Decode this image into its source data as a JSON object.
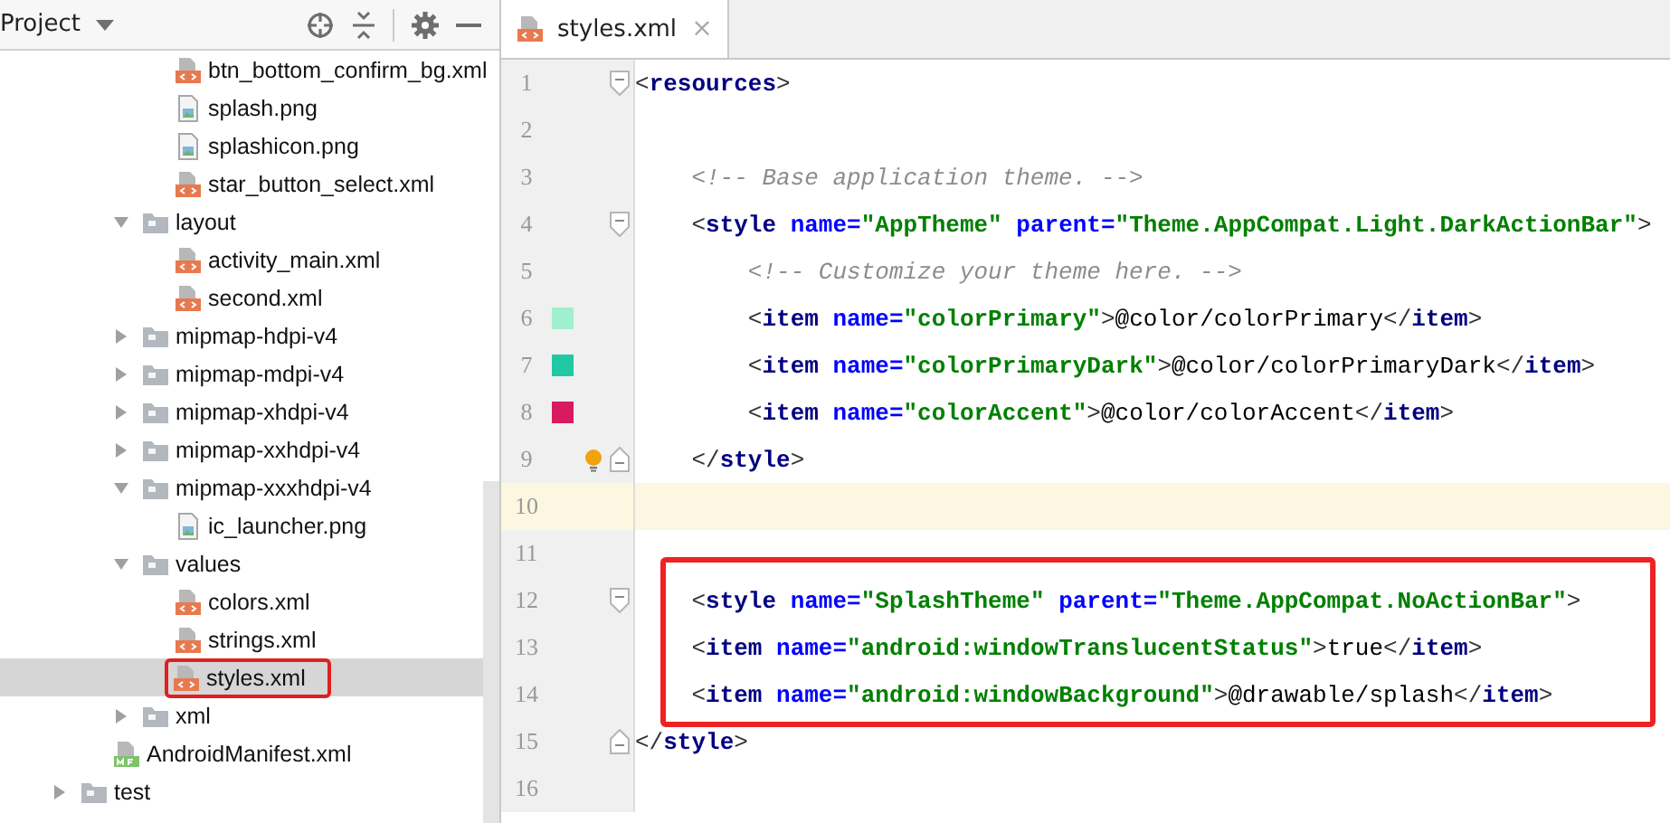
{
  "project_panel": {
    "title": "Project",
    "tree": [
      {
        "children": [
          {
            "children": [
              {
                "children": [
                  {
                    "label": "btn_bottom_confirm_bg.xml",
                    "kind": "xml",
                    "selected": false,
                    "boxed": false
                  },
                  {
                    "label": "splash.png",
                    "kind": "png",
                    "selected": false,
                    "boxed": false
                  },
                  {
                    "label": "splashicon.png",
                    "kind": "png",
                    "selected": false,
                    "boxed": false
                  },
                  {
                    "label": "star_button_select.xml",
                    "kind": "xml",
                    "selected": false,
                    "boxed": false
                  }
                ]
              },
              {
                "label": "layout",
                "kind": "folder",
                "expanded": true,
                "children": [
                  {
                    "label": "activity_main.xml",
                    "kind": "xml",
                    "selected": false,
                    "boxed": false
                  },
                  {
                    "label": "second.xml",
                    "kind": "xml",
                    "selected": false,
                    "boxed": false
                  }
                ]
              },
              {
                "label": "mipmap-hdpi-v4",
                "kind": "folder",
                "expanded": false
              },
              {
                "label": "mipmap-mdpi-v4",
                "kind": "folder",
                "expanded": false
              },
              {
                "label": "mipmap-xhdpi-v4",
                "kind": "folder",
                "expanded": false
              },
              {
                "label": "mipmap-xxhdpi-v4",
                "kind": "folder",
                "expanded": false
              },
              {
                "label": "mipmap-xxxhdpi-v4",
                "kind": "folder",
                "expanded": true,
                "children": [
                  {
                    "label": "ic_launcher.png",
                    "kind": "png",
                    "selected": false,
                    "boxed": false
                  }
                ]
              },
              {
                "label": "values",
                "kind": "folder",
                "expanded": true,
                "children": [
                  {
                    "label": "colors.xml",
                    "kind": "xml",
                    "selected": false,
                    "boxed": false
                  },
                  {
                    "label": "strings.xml",
                    "kind": "xml",
                    "selected": false,
                    "boxed": false
                  },
                  {
                    "label": "styles.xml",
                    "kind": "xml",
                    "selected": true,
                    "boxed": true
                  }
                ]
              },
              {
                "label": "xml",
                "kind": "folder",
                "expanded": false
              }
            ]
          },
          {
            "label": "AndroidManifest.xml",
            "kind": "manifest",
            "selected": false,
            "boxed": false
          }
        ]
      },
      {
        "label": "test",
        "kind": "folder",
        "expanded": false
      }
    ]
  },
  "editor": {
    "tabs": [
      {
        "label": "styles.xml",
        "selected": true,
        "close": "×"
      }
    ],
    "lines": [
      {
        "number": "1",
        "fold_start": true,
        "tokens": [
          {
            "kind": "p",
            "t": "<"
          },
          {
            "kind": "tag",
            "t": "resources"
          },
          {
            "kind": "p",
            "t": ">"
          }
        ]
      },
      {
        "number": "2"
      },
      {
        "number": "3",
        "tokens": [
          {
            "kind": "comment",
            "t": "    <!-- Base application theme. -->"
          }
        ]
      },
      {
        "number": "4",
        "fold_start": true,
        "tokens": [
          {
            "kind": "p",
            "t": "    <"
          },
          {
            "kind": "tag",
            "t": "style "
          },
          {
            "kind": "attr",
            "t": "name="
          },
          {
            "kind": "value",
            "t": "\"AppTheme\" "
          },
          {
            "kind": "attr",
            "t": "parent="
          },
          {
            "kind": "value",
            "t": "\"Theme.AppCompat.Light.DarkActionBar\""
          },
          {
            "kind": "p",
            "t": ">"
          }
        ]
      },
      {
        "number": "5",
        "tokens": [
          {
            "kind": "comment",
            "t": "        <!-- Customize your theme here. -->"
          }
        ]
      },
      {
        "number": "6",
        "color": "#a0f0d0",
        "tokens": [
          {
            "kind": "p",
            "t": "        <"
          },
          {
            "kind": "tag",
            "t": "item "
          },
          {
            "kind": "attr",
            "t": "name="
          },
          {
            "kind": "value",
            "t": "\"colorPrimary\""
          },
          {
            "kind": "p",
            "t": ">"
          },
          {
            "kind": "text",
            "t": "@color/colorPrimary"
          },
          {
            "kind": "p",
            "t": "</"
          },
          {
            "kind": "tag",
            "t": "item"
          },
          {
            "kind": "p",
            "t": ">"
          }
        ]
      },
      {
        "number": "7",
        "color": "#22c8a4",
        "tokens": [
          {
            "kind": "p",
            "t": "        <"
          },
          {
            "kind": "tag",
            "t": "item "
          },
          {
            "kind": "attr",
            "t": "name="
          },
          {
            "kind": "value",
            "t": "\"colorPrimaryDark\""
          },
          {
            "kind": "p",
            "t": ">"
          },
          {
            "kind": "text",
            "t": "@color/colorPrimaryDark"
          },
          {
            "kind": "p",
            "t": "</"
          },
          {
            "kind": "tag",
            "t": "item"
          },
          {
            "kind": "p",
            "t": ">"
          }
        ]
      },
      {
        "number": "8",
        "color": "#d81b60",
        "tokens": [
          {
            "kind": "p",
            "t": "        <"
          },
          {
            "kind": "tag",
            "t": "item "
          },
          {
            "kind": "attr",
            "t": "name="
          },
          {
            "kind": "value",
            "t": "\"colorAccent\""
          },
          {
            "kind": "p",
            "t": ">"
          },
          {
            "kind": "text",
            "t": "@color/colorAccent"
          },
          {
            "kind": "p",
            "t": "</"
          },
          {
            "kind": "tag",
            "t": "item"
          },
          {
            "kind": "p",
            "t": ">"
          }
        ]
      },
      {
        "number": "9",
        "fold_end": true,
        "bulb": true,
        "tokens": [
          {
            "kind": "p",
            "t": "    </"
          },
          {
            "kind": "tag",
            "t": "style"
          },
          {
            "kind": "p",
            "t": ">"
          }
        ]
      },
      {
        "number": "10",
        "current": true
      },
      {
        "number": "11"
      },
      {
        "number": "12",
        "fold_start": true,
        "boxed": true,
        "tokens": [
          {
            "kind": "p",
            "t": "    <"
          },
          {
            "kind": "tag",
            "t": "style "
          },
          {
            "kind": "attr",
            "t": "name="
          },
          {
            "kind": "value",
            "t": "\"SplashTheme\" "
          },
          {
            "kind": "attr",
            "t": "parent="
          },
          {
            "kind": "value",
            "t": "\"Theme.AppCompat.NoActionBar\""
          },
          {
            "kind": "p",
            "t": ">"
          }
        ]
      },
      {
        "number": "13",
        "boxed": true,
        "tokens": [
          {
            "kind": "p",
            "t": "    <"
          },
          {
            "kind": "tag",
            "t": "item "
          },
          {
            "kind": "attr",
            "t": "name="
          },
          {
            "kind": "value",
            "t": "\"android:windowTranslucentStatus\""
          },
          {
            "kind": "p",
            "t": ">"
          },
          {
            "kind": "text",
            "t": "true"
          },
          {
            "kind": "p",
            "t": "</"
          },
          {
            "kind": "tag",
            "t": "item"
          },
          {
            "kind": "p",
            "t": ">"
          }
        ]
      },
      {
        "number": "14",
        "boxed": true,
        "tokens": [
          {
            "kind": "p",
            "t": "    <"
          },
          {
            "kind": "tag",
            "t": "item "
          },
          {
            "kind": "attr",
            "t": "name="
          },
          {
            "kind": "value",
            "t": "\"android:windowBackground\""
          },
          {
            "kind": "p",
            "t": ">"
          },
          {
            "kind": "text",
            "t": "@drawable/splash"
          },
          {
            "kind": "p",
            "t": "</"
          },
          {
            "kind": "tag",
            "t": "item"
          },
          {
            "kind": "p",
            "t": ">"
          }
        ]
      },
      {
        "number": "15",
        "fold_end": true,
        "tokens": [
          {
            "kind": "p",
            "t": "</"
          },
          {
            "kind": "tag",
            "t": "style"
          },
          {
            "kind": "p",
            "t": ">"
          }
        ]
      },
      {
        "number": "16"
      }
    ]
  }
}
